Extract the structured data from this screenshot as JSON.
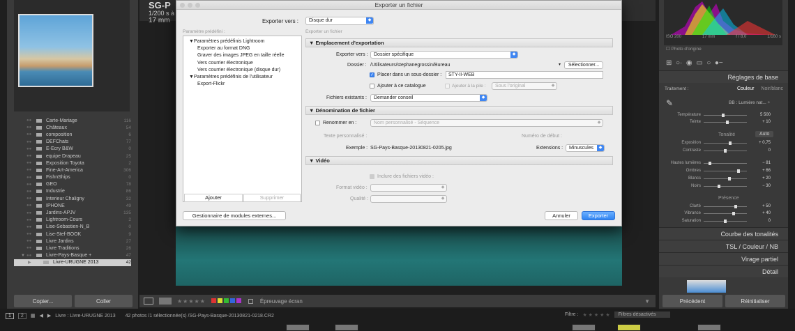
{
  "background": {
    "center": {
      "title": "SG-P",
      "exposure": "1/200 s à",
      "focal": "17 mm"
    },
    "collections": [
      {
        "name": "Carte-Mariage",
        "count": "116"
      },
      {
        "name": "Châteaux",
        "count": "54"
      },
      {
        "name": "composition",
        "count": "6"
      },
      {
        "name": "DEFChats",
        "count": "77"
      },
      {
        "name": "E-Ecry B&W",
        "count": "0"
      },
      {
        "name": "equipe Drapeau",
        "count": "25"
      },
      {
        "name": "Exposition Toyota",
        "count": "2"
      },
      {
        "name": "Fine-Art-America",
        "count": "306"
      },
      {
        "name": "FishnShips",
        "count": "0"
      },
      {
        "name": "GEO",
        "count": "78"
      },
      {
        "name": "Industrie",
        "count": "86"
      },
      {
        "name": "Interieur Chaligny",
        "count": "32"
      },
      {
        "name": "IPHONE",
        "count": "49"
      },
      {
        "name": "Jardins-APJV",
        "count": "135"
      },
      {
        "name": "Lightroom-Cours",
        "count": "2"
      },
      {
        "name": "Lise-Sebastien-N_B",
        "count": "0"
      },
      {
        "name": "Lise-Stef-BOOK",
        "count": "9"
      },
      {
        "name": "Livre Jardins",
        "count": "27"
      },
      {
        "name": "Livre Traditions",
        "count": "26"
      },
      {
        "name": "Livre-Pays-Basque +",
        "count": "47"
      },
      {
        "name": "Livre-URUGNE 2013",
        "count": "42"
      }
    ],
    "left_buttons": {
      "copy": "Copier...",
      "paste": "Coller"
    },
    "toolbar": {
      "stars": "★★★★★",
      "proof": "Épreuvage écran"
    },
    "histogram": {
      "iso": "ISO 200",
      "focal": "17 mm",
      "aperture": "f / 8,0",
      "speed": "1/160 s",
      "photo_orig": "Photo d'origine"
    },
    "right": {
      "reglages": "Réglages de base",
      "traitement": "Traitement :",
      "couleur": "Couleur",
      "noir_blanc": "Noir/blanc",
      "bb": "BB :",
      "bb_val": "Lumière nat... ÷",
      "temperature": {
        "label": "Température",
        "value": "5 500",
        "pos": 0.45
      },
      "teinte": {
        "label": "Teinte",
        "value": "+ 10",
        "pos": 0.55
      },
      "tonalite": "Tonalité",
      "auto": "Auto",
      "exposition": {
        "label": "Exposition",
        "value": "+ 0,75",
        "pos": 0.62
      },
      "contraste": {
        "label": "Contraste",
        "value": "0",
        "pos": 0.5
      },
      "hautes": {
        "label": "Hautes lumières",
        "value": "− 81",
        "pos": 0.12
      },
      "ombres": {
        "label": "Ombres",
        "value": "+ 66",
        "pos": 0.83
      },
      "blancs": {
        "label": "Blancs",
        "value": "+ 20",
        "pos": 0.6
      },
      "noirs": {
        "label": "Noirs",
        "value": "− 30",
        "pos": 0.35
      },
      "presence": "Présence",
      "clarte": {
        "label": "Clarté",
        "value": "+ 50",
        "pos": 0.75
      },
      "vibrance": {
        "label": "Vibrance",
        "value": "+ 40",
        "pos": 0.7
      },
      "saturation": {
        "label": "Saturation",
        "value": "0",
        "pos": 0.5
      },
      "courbe": "Courbe des tonalités",
      "tsl": "TSL / Couleur / NB",
      "virage": "Virage partiel",
      "detail": "Détail",
      "precedent": "Précédent",
      "reinitialiser": "Réinitialiser"
    },
    "bottom": {
      "page1": "1",
      "page2": "2",
      "path": "Livre : Livre-URUGNE 2013",
      "selection": "42 photos /1 sélectionnée(s) /SG-Pays-Basque-20130821-0218.CR2",
      "filter": "Filtre :",
      "filter_value": "Filtres désactivés"
    }
  },
  "dialog": {
    "title": "Exporter un fichier",
    "export_to_label": "Exporter vers :",
    "export_to_value": "Disque dur",
    "presets_label": "Paramètre prédéfini :",
    "export_file_label": "Exporter un fichier",
    "presets": [
      {
        "text": "▼Paramètres prédéfinis Lightroom",
        "indent": 0
      },
      {
        "text": "Exporter au format DNG",
        "indent": 1
      },
      {
        "text": "Graver des images JPEG en taille réelle",
        "indent": 1
      },
      {
        "text": "Vers courrier électronique",
        "indent": 1
      },
      {
        "text": "Vers courrier électronique (disque dur)",
        "indent": 1
      },
      {
        "text": "▼Paramètres prédéfinis de l'utilisateur",
        "indent": 0
      },
      {
        "text": "Export-Flickr",
        "indent": 1
      }
    ],
    "add_button": "Ajouter",
    "remove_button": "Supprimer",
    "plugin_button": "Gestionnaire de modules externes...",
    "cancel_button": "Annuler",
    "export_button": "Exporter",
    "sec_location": "▼ Emplacement d'exportation",
    "exporter_vers_label": "Exporter vers :",
    "exporter_vers_value": "Dossier spécifique",
    "dossier_label": "Dossier :",
    "dossier_value": "/Utilisateurs/stephanegrossin/Bureau",
    "select_button": "Sélectionner...",
    "subfolder_label": "Placer dans un sous-dossier :",
    "subfolder_value": "STY-II-WEB",
    "add_catalog": "Ajouter à ce catalogue",
    "add_stack": "Ajouter à la pile :",
    "stack_value": "Sous l'original",
    "existing_label": "Fichiers existants :",
    "existing_value": "Demander conseil",
    "sec_naming": "▼ Dénomination de fichier",
    "rename_label": "Renommer en :",
    "rename_value": "Nom personnalisé - Séquence",
    "custom_text": "Texte personnalisé :",
    "start_number": "Numéro de début :",
    "example_label": "Exemple :",
    "example_value": "SG-Pays-Basque-20130821-0205.jpg",
    "extensions_label": "Extensions :",
    "extensions_value": "Minuscules",
    "sec_video": "▼ Vidéo",
    "include_video": "Inclure des fichiers vidéo :",
    "video_format": "Format vidéo :",
    "quality": "Qualité :"
  }
}
